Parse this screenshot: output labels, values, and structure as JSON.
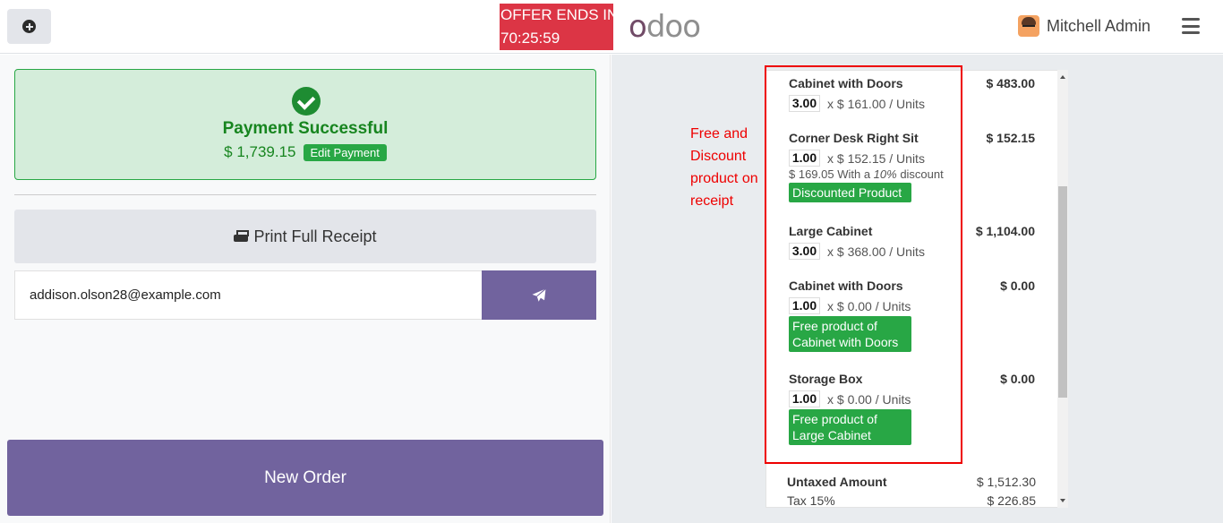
{
  "header": {
    "new_order_icon": "plus-circle-icon",
    "offer_line1": "OFFER ENDS IN",
    "offer_line2": "70:25:59",
    "logo_first": "o",
    "logo_rest": "doo",
    "user_name": "Mitchell Admin",
    "menu_icon": "hamburger-icon"
  },
  "payment": {
    "status_title": "Payment Successful",
    "amount": "$ 1,739.15",
    "edit_label": "Edit Payment"
  },
  "actions": {
    "print_label": "Print Full Receipt",
    "email_value": "addison.olson28@example.com",
    "send_icon": "paper-plane-icon",
    "new_order_label": "New Order"
  },
  "annotation": {
    "note": "Free and Discount product on receipt"
  },
  "receipt": {
    "lines": [
      {
        "name": "Cabinet with Doors",
        "price": "$ 483.00",
        "qty": "3.00",
        "unit": "x $ 161.00 / Units"
      },
      {
        "name": "Corner Desk Right Sit",
        "price": "$ 152.15",
        "qty": "1.00",
        "unit": "x $ 152.15 / Units",
        "discount_prefix": "$ 169.05 With a ",
        "discount_pct": "10%",
        "discount_suffix": " discount",
        "badge": "Discounted Product"
      },
      {
        "name": "Large Cabinet",
        "price": "$ 1,104.00",
        "qty": "3.00",
        "unit": "x $ 368.00 / Units"
      },
      {
        "name": "Cabinet with Doors",
        "price": "$ 0.00",
        "qty": "1.00",
        "unit": "x $ 0.00 / Units",
        "badge": "Free product of Cabinet with Doors"
      },
      {
        "name": "Storage Box",
        "price": "$ 0.00",
        "qty": "1.00",
        "unit": "x $ 0.00 / Units",
        "badge": "Free product of Large Cabinet"
      }
    ],
    "untaxed_label": "Untaxed Amount",
    "untaxed_value": "$ 1,512.30",
    "tax_label": "Tax 15%",
    "tax_value": "$ 226.85"
  },
  "colors": {
    "accent": "#71639e",
    "success": "#28a745",
    "offer": "#dc3545",
    "annotation": "#ee0000"
  }
}
